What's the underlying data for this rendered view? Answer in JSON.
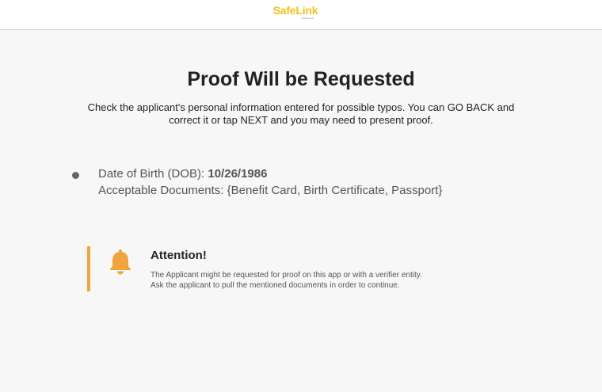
{
  "header": {
    "logo_text": "SafeLink",
    "logo_sub": "WIRELESS"
  },
  "main": {
    "title": "Proof Will be Requested",
    "subtitle": "Check the applicant's personal information entered for possible typos. You can GO BACK and correct it or tap NEXT and you may need to present proof.",
    "dob_label": "Date of Birth (DOB): ",
    "dob_value": "10/26/1986",
    "docs_line": "Acceptable Documents: {Benefit Card, Birth Certificate, Passport}"
  },
  "attention": {
    "title": "Attention!",
    "line1": "The Applicant might be requested for proof on this app or with a verifier entity.",
    "line2": "Ask the applicant to pull the mentioned documents in order to continue.",
    "icon": "bell-icon"
  },
  "colors": {
    "brand_yellow": "#f2c31a",
    "accent_orange": "#f0a53c",
    "background": "#f7f7f7"
  }
}
